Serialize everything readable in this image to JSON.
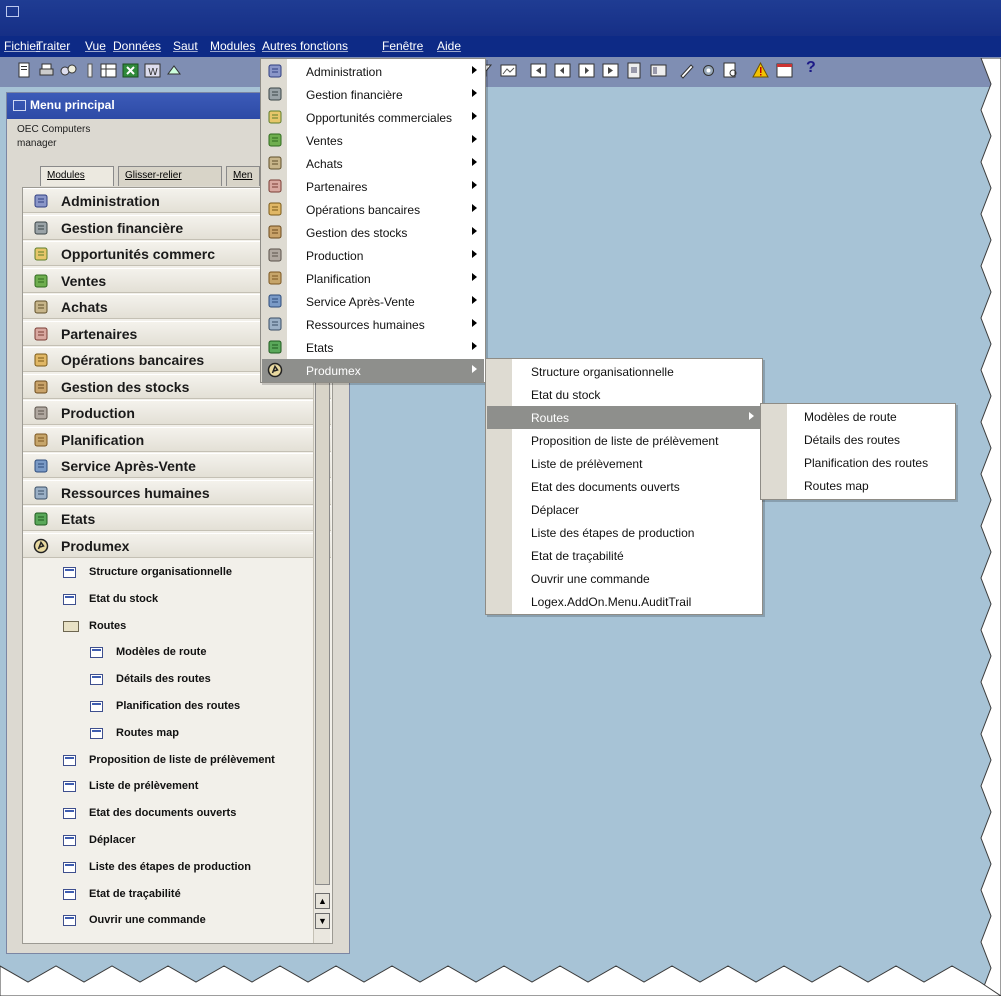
{
  "menubar": {
    "items": [
      "Fichier",
      "Traiter",
      "Vue",
      "Données",
      "Saut",
      "Modules",
      "Autres fonctions",
      "Fenêtre",
      "Aide"
    ]
  },
  "toolbar": {
    "help_label": "?"
  },
  "main_window": {
    "title": "Menu principal",
    "company": "OEC Computers",
    "user": "manager",
    "tabs": [
      "Modules",
      "Glisser-relier",
      "Men"
    ],
    "modules": [
      "Administration",
      "Gestion financière",
      "Opportunités commerc",
      "Ventes",
      "Achats",
      "Partenaires",
      "Opérations bancaires",
      "Gestion des stocks",
      "Production",
      "Planification",
      "Service Après-Vente",
      "Ressources humaines",
      "Etats",
      "Produmex"
    ],
    "tree": [
      {
        "label": "Structure organisationnelle",
        "level": 1,
        "kind": "form"
      },
      {
        "label": "Etat du stock",
        "level": 1,
        "kind": "form"
      },
      {
        "label": "Routes",
        "level": 1,
        "kind": "folder"
      },
      {
        "label": "Modèles de route",
        "level": 2,
        "kind": "form"
      },
      {
        "label": "Détails des routes",
        "level": 2,
        "kind": "form"
      },
      {
        "label": "Planification des routes",
        "level": 2,
        "kind": "form"
      },
      {
        "label": "Routes map",
        "level": 2,
        "kind": "form"
      },
      {
        "label": "Proposition de liste de prélèvement",
        "level": 1,
        "kind": "form"
      },
      {
        "label": "Liste de prélèvement",
        "level": 1,
        "kind": "form"
      },
      {
        "label": "Etat des documents ouverts",
        "level": 1,
        "kind": "form"
      },
      {
        "label": "Déplacer",
        "level": 1,
        "kind": "form"
      },
      {
        "label": "Liste des étapes de production",
        "level": 1,
        "kind": "form"
      },
      {
        "label": "Etat de traçabilité",
        "level": 1,
        "kind": "form"
      },
      {
        "label": "Ouvrir une commande",
        "level": 1,
        "kind": "form"
      }
    ]
  },
  "modules_menu": {
    "items": [
      "Administration",
      "Gestion financière",
      "Opportunités commerciales",
      "Ventes",
      "Achats",
      "Partenaires",
      "Opérations bancaires",
      "Gestion des stocks",
      "Production",
      "Planification",
      "Service Après-Vente",
      "Ressources humaines",
      "Etats",
      "Produmex"
    ],
    "highlighted": "Produmex"
  },
  "produmex_menu": {
    "items": [
      "Structure organisationnelle",
      "Etat du stock",
      "Routes",
      "Proposition de liste de prélèvement",
      "Liste de prélèvement",
      "Etat des documents ouverts",
      "Déplacer",
      "Liste des étapes de production",
      "Etat de traçabilité",
      "Ouvrir une commande",
      "Logex.AddOn.Menu.AuditTrail"
    ],
    "highlighted": "Routes"
  },
  "routes_menu": {
    "items": [
      "Modèles de route",
      "Détails des routes",
      "Planification des routes",
      "Routes map"
    ]
  },
  "colors": {
    "titlebar": "#1f3c93",
    "menubar": "#0d2a86",
    "toolbar": "#7f8eb3",
    "desktop": "#a7c3d6",
    "highlight": "#8e8f8c",
    "window_title": "#3c5bb8"
  }
}
